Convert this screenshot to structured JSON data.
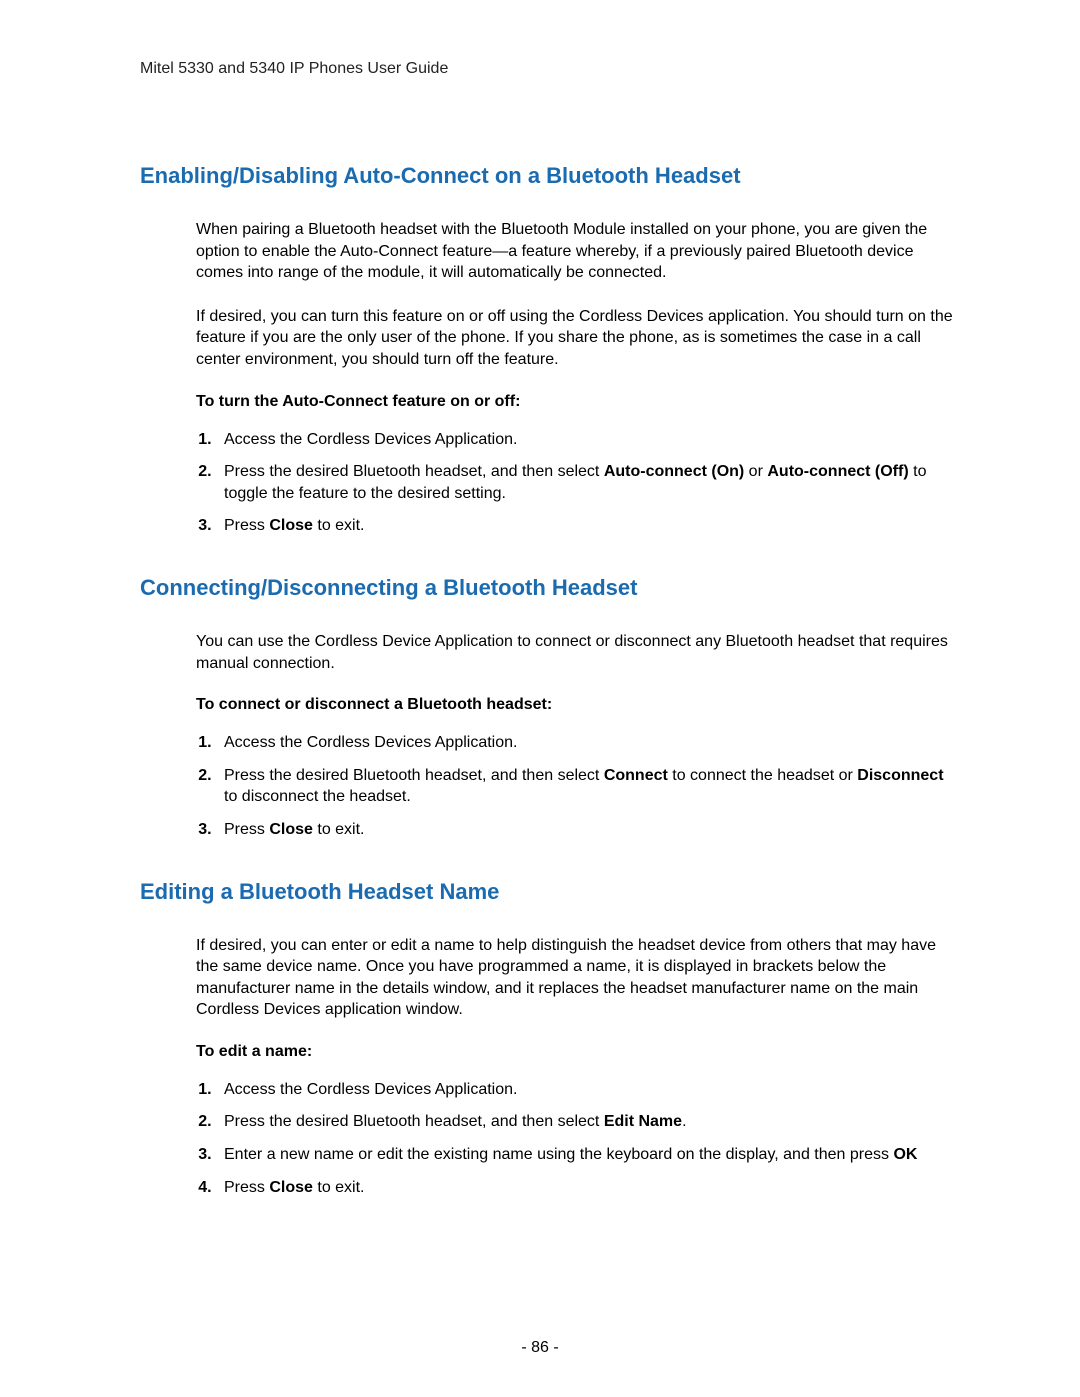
{
  "header": "Mitel 5330 and 5340 IP Phones User Guide",
  "section1": {
    "title": "Enabling/Disabling Auto-Connect on a Bluetooth Headset",
    "para1": "When pairing a Bluetooth headset with the Bluetooth Module installed on your phone, you are given the option to enable the Auto-Connect feature—a feature whereby, if a previously paired Bluetooth device comes into range of the module, it will automatically be connected.",
    "para2": "If desired, you can turn this feature on or off using the Cordless Devices application. You should turn on the feature if you are the only user of the phone. If you share the phone, as is sometimes the case in a call center environment, you should turn off the feature.",
    "subhead": "To turn the Auto-Connect feature on or off:",
    "step1": "Access the Cordless Devices Application.",
    "step2a": "Press the desired Bluetooth headset, and then select ",
    "step2b1": "Auto-connect (On)",
    "step2c": " or ",
    "step2b2": "Auto-connect (Off)",
    "step2d": " to toggle the feature to the desired setting.",
    "step3a": "Press ",
    "step3b": "Close",
    "step3c": " to exit."
  },
  "section2": {
    "title": "Connecting/Disconnecting a Bluetooth Headset",
    "para1": "You can use the Cordless Device Application to connect or disconnect any Bluetooth headset that requires manual connection.",
    "subhead": "To connect or disconnect a Bluetooth headset:",
    "step1": "Access the Cordless Devices Application.",
    "step2a": "Press the desired Bluetooth headset, and then select ",
    "step2b1": "Connect",
    "step2c": " to connect the headset or ",
    "step2b2": "Disconnect",
    "step2d": " to disconnect the headset.",
    "step3a": "Press ",
    "step3b": "Close",
    "step3c": " to exit."
  },
  "section3": {
    "title": "Editing a Bluetooth Headset Name",
    "para1": "If desired, you can enter or edit a name to help distinguish the headset device from others that may have the same device name. Once you have programmed a name, it is displayed in brackets below the manufacturer name in the details window, and it replaces the headset manufacturer name on the main Cordless Devices application window.",
    "subhead": "To edit a name:",
    "step1": "Access the Cordless Devices Application.",
    "step2a": "Press the desired Bluetooth headset, and then select ",
    "step2b": "Edit Name",
    "step2c": ".",
    "step3a": "Enter a new name or edit the existing name using the keyboard on the display, and then press ",
    "step3b": "OK",
    "step4a": "Press ",
    "step4b": "Close",
    "step4c": " to exit."
  },
  "pageNumber": "- 86 -"
}
